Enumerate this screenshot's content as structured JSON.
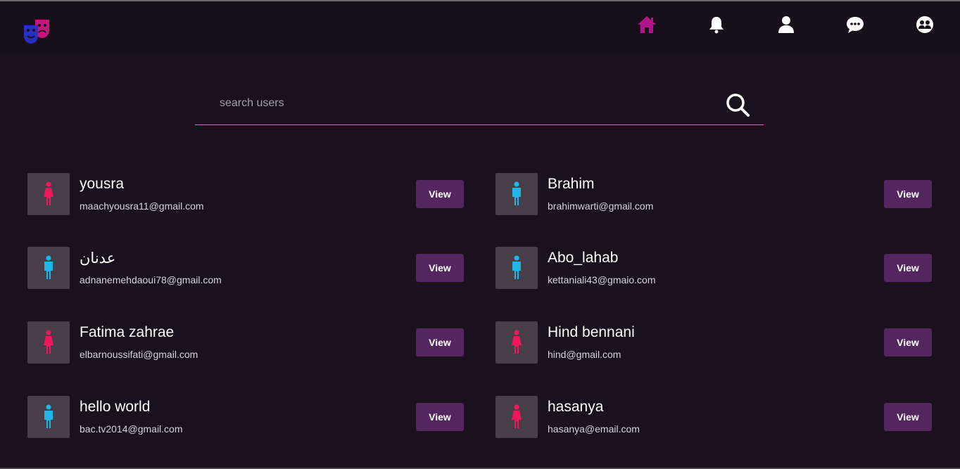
{
  "nav": {
    "logo": "theater-masks-logo",
    "icons": [
      {
        "name": "home-icon",
        "color": "#b0168a"
      },
      {
        "name": "bell-icon",
        "color": "#ffffff"
      },
      {
        "name": "user-icon",
        "color": "#ffffff"
      },
      {
        "name": "chat-icon",
        "color": "#ffffff"
      },
      {
        "name": "users-circle-icon",
        "color": "#ffffff"
      }
    ]
  },
  "search": {
    "placeholder": "search users",
    "value": ""
  },
  "users": [
    {
      "name": "yousra",
      "email": "maachyousra11@gmail.com",
      "gender": "female",
      "view_label": "View"
    },
    {
      "name": "Brahim",
      "email": "brahimwarti@gmail.com",
      "gender": "male",
      "view_label": "View"
    },
    {
      "name": "عدنان",
      "email": "adnanemehdaoui78@gmail.com",
      "gender": "male",
      "view_label": "View"
    },
    {
      "name": "Abo_lahab",
      "email": "kettaniali43@gmaio.com",
      "gender": "male",
      "view_label": "View"
    },
    {
      "name": "Fatima zahrae",
      "email": "elbarnoussifati@gmail.com",
      "gender": "female",
      "view_label": "View"
    },
    {
      "name": "Hind bennani",
      "email": "hind@gmail.com",
      "gender": "female",
      "view_label": "View"
    },
    {
      "name": "hello world",
      "email": "bac.tv2014@gmail.com",
      "gender": "male",
      "view_label": "View"
    },
    {
      "name": "hasanya",
      "email": "hasanya@email.com",
      "gender": "female",
      "view_label": "View"
    }
  ],
  "colors": {
    "background": "#1b111e",
    "navbar": "#170f1a",
    "accent": "#b0168a",
    "button": "#53265f",
    "search_underline": "#3ab7c9",
    "male_icon": "#1fb8e6",
    "female_icon": "#f0175f",
    "avatar_bg": "#473e4a"
  }
}
